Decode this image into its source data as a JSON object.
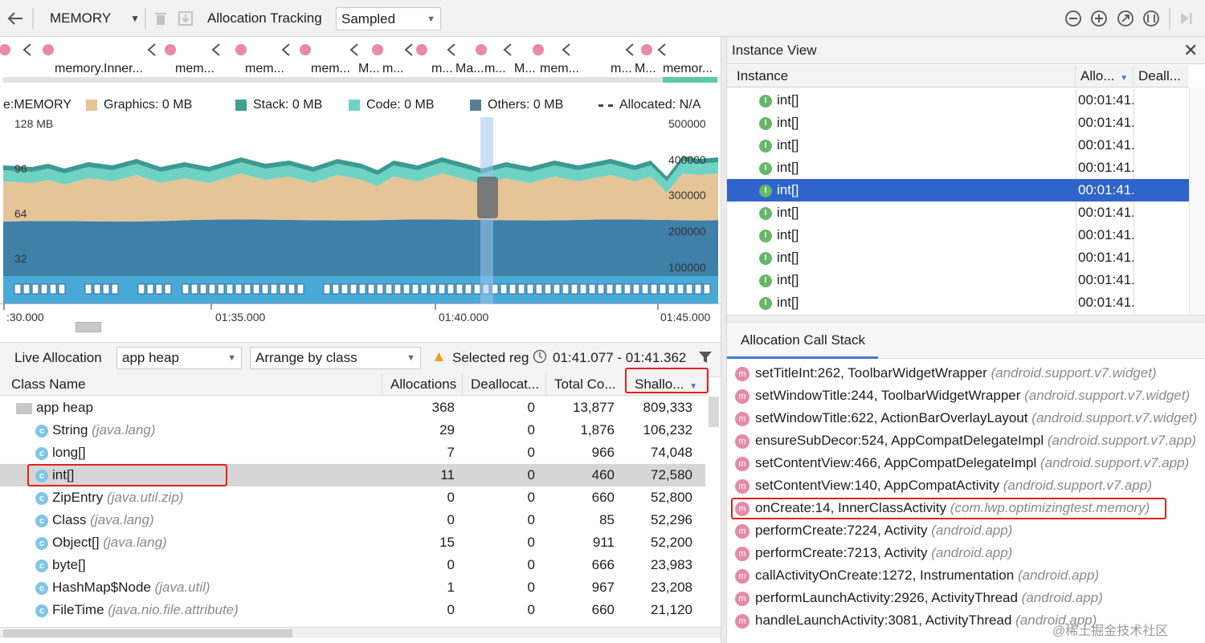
{
  "toolbar": {
    "profiler_label": "MEMORY",
    "allocation_tracking_label": "Allocation Tracking",
    "sampling_value": "Sampled"
  },
  "timeline": {
    "event_labels": [
      "memory.Inner...",
      "mem...",
      "mem...",
      "mem...",
      "M...",
      "m...",
      "m...",
      "Ma...",
      "m...",
      "M...",
      "mem...",
      "m...",
      "M...",
      "memor..."
    ],
    "legend_prefix": "e:MEMORY",
    "legend": [
      {
        "label": "Graphics: 0 MB",
        "color": "#e5c597"
      },
      {
        "label": "Stack: 0 MB",
        "color": "#3fa18f"
      },
      {
        "label": "Code: 0 MB",
        "color": "#6fd3c4"
      },
      {
        "label": "Others: 0 MB",
        "color": "#5b7c99"
      },
      {
        "label": "Allocated: N/A",
        "color": "#2f4a64"
      }
    ],
    "y_left": [
      "128 MB",
      "96",
      "64",
      "32"
    ],
    "y_right": [
      "500000",
      "400000",
      "300000",
      "200000",
      "100000"
    ],
    "x_ticks": [
      ":30.000",
      "01:35.000",
      "01:40.000",
      "01:45.000"
    ]
  },
  "live_allocation": {
    "label": "Live Allocation",
    "heap_value": "app heap",
    "arrange_value": "Arrange by class",
    "selected_label": "Selected reg",
    "time_range": "01:41.077 - 01:41.362"
  },
  "table": {
    "headers": [
      "Class Name",
      "Allocations",
      "Deallocat...",
      "Total Co...",
      "Shallo..."
    ],
    "rows": [
      {
        "name": "app heap",
        "pkg": "",
        "alloc": "368",
        "dealloc": "0",
        "total": "13,877",
        "shallow": "809,333"
      },
      {
        "name": "String",
        "pkg": "(java.lang)",
        "alloc": "29",
        "dealloc": "0",
        "total": "1,876",
        "shallow": "106,232"
      },
      {
        "name": "long[]",
        "pkg": "",
        "alloc": "7",
        "dealloc": "0",
        "total": "966",
        "shallow": "74,048"
      },
      {
        "name": "int[]",
        "pkg": "",
        "alloc": "11",
        "dealloc": "0",
        "total": "460",
        "shallow": "72,580"
      },
      {
        "name": "ZipEntry",
        "pkg": "(java.util.zip)",
        "alloc": "0",
        "dealloc": "0",
        "total": "660",
        "shallow": "52,800"
      },
      {
        "name": "Class",
        "pkg": "(java.lang)",
        "alloc": "0",
        "dealloc": "0",
        "total": "85",
        "shallow": "52,296"
      },
      {
        "name": "Object[]",
        "pkg": "(java.lang)",
        "alloc": "15",
        "dealloc": "0",
        "total": "911",
        "shallow": "52,200"
      },
      {
        "name": "byte[]",
        "pkg": "",
        "alloc": "0",
        "dealloc": "0",
        "total": "666",
        "shallow": "23,983"
      },
      {
        "name": "HashMap$Node",
        "pkg": "(java.util)",
        "alloc": "1",
        "dealloc": "0",
        "total": "967",
        "shallow": "23,208"
      },
      {
        "name": "FileTime",
        "pkg": "(java.nio.file.attribute)",
        "alloc": "0",
        "dealloc": "0",
        "total": "660",
        "shallow": "21,120"
      }
    ]
  },
  "instance_view": {
    "title": "Instance View",
    "headers": [
      "Instance",
      "Allo...",
      "Deall..."
    ],
    "rows": [
      {
        "name": "int[]",
        "time": "00:01:41."
      },
      {
        "name": "int[]",
        "time": "00:01:41."
      },
      {
        "name": "int[]",
        "time": "00:01:41."
      },
      {
        "name": "int[]",
        "time": "00:01:41."
      },
      {
        "name": "int[]",
        "time": "00:01:41."
      },
      {
        "name": "int[]",
        "time": "00:01:41."
      },
      {
        "name": "int[]",
        "time": "00:01:41."
      },
      {
        "name": "int[]",
        "time": "00:01:41."
      },
      {
        "name": "int[]",
        "time": "00:01:41."
      },
      {
        "name": "int[]",
        "time": "00:01:41."
      }
    ]
  },
  "call_stack": {
    "tab": "Allocation Call Stack",
    "rows": [
      {
        "method": "setTitleInt:262, ToolbarWidgetWrapper",
        "pkg": "(android.support.v7.widget)"
      },
      {
        "method": "setWindowTitle:244, ToolbarWidgetWrapper",
        "pkg": "(android.support.v7.widget)"
      },
      {
        "method": "setWindowTitle:622, ActionBarOverlayLayout",
        "pkg": "(android.support.v7.widget)"
      },
      {
        "method": "ensureSubDecor:524, AppCompatDelegateImpl",
        "pkg": "(android.support.v7.app)"
      },
      {
        "method": "setContentView:466, AppCompatDelegateImpl",
        "pkg": "(android.support.v7.app)"
      },
      {
        "method": "setContentView:140, AppCompatActivity",
        "pkg": "(android.support.v7.app)"
      },
      {
        "method": "onCreate:14, InnerClassActivity",
        "pkg": "(com.lwp.optimizingtest.memory)"
      },
      {
        "method": "performCreate:7224, Activity",
        "pkg": "(android.app)"
      },
      {
        "method": "performCreate:7213, Activity",
        "pkg": "(android.app)"
      },
      {
        "method": "callActivityOnCreate:1272, Instrumentation",
        "pkg": "(android.app)"
      },
      {
        "method": "performLaunchActivity:2926, ActivityThread",
        "pkg": "(android.app)"
      },
      {
        "method": "handleLaunchActivity:3081, ActivityThread",
        "pkg": "(android.app)"
      }
    ]
  },
  "watermark": "@稀土掘金技术社区",
  "colors": {
    "selected_row": "#2f65ca",
    "highlight_box": "#e0221e",
    "graphics": "#e5c597",
    "others": "#3f80a8",
    "stack": "#3fa18f",
    "code": "#6fd3c4"
  }
}
